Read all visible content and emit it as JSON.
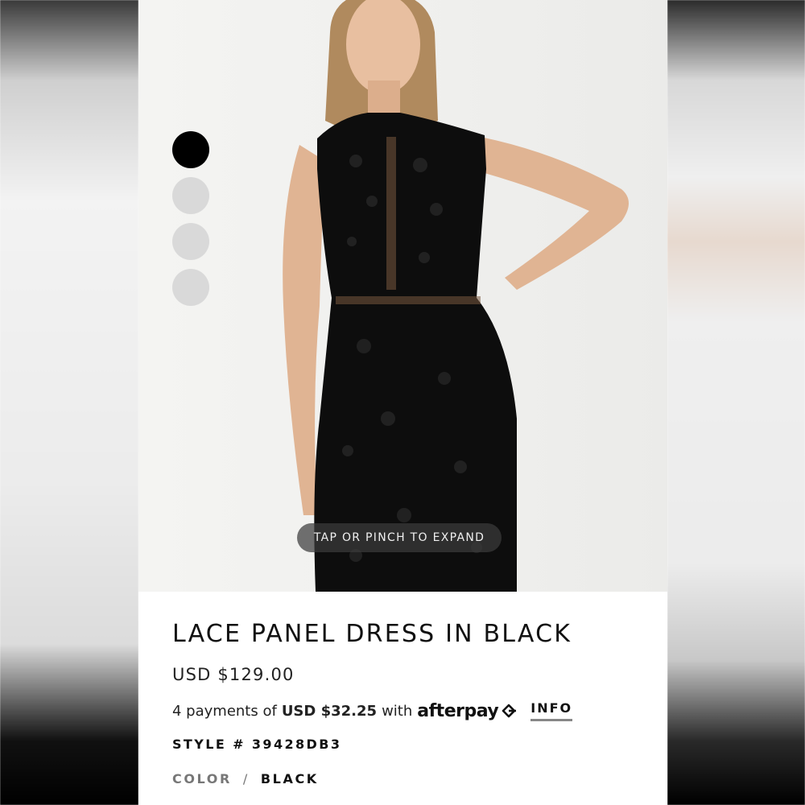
{
  "image_viewer": {
    "expand_hint": "TAP OR PINCH TO EXPAND",
    "thumbnails": [
      {
        "state": "active"
      },
      {
        "state": "inactive"
      },
      {
        "state": "inactive"
      },
      {
        "state": "inactive"
      }
    ]
  },
  "product": {
    "title": "LACE PANEL DRESS IN BLACK",
    "price": "USD $129.00",
    "afterpay": {
      "prefix": "4 payments of",
      "amount": "USD $32.25",
      "with": "with",
      "brand": "afterpay",
      "info_label": "INFO"
    },
    "style": "STYLE # 39428DB3",
    "color": {
      "label": "COLOR",
      "separator": "/",
      "value": "BLACK"
    }
  },
  "colors": {
    "active_dot": "#000000",
    "inactive_dot": "#d9d9d9",
    "pill_bg": "#3c3c3c"
  }
}
